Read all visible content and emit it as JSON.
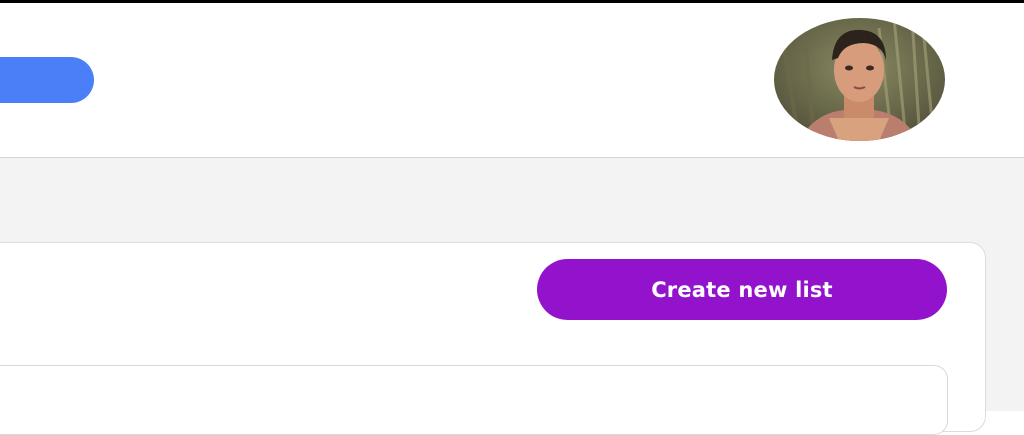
{
  "header": {
    "primary_button_label": "",
    "avatar_icon": "user-avatar-photo"
  },
  "list_panel": {
    "create_button_label": "Create new list"
  },
  "colors": {
    "primary_blue": "#4a7ff7",
    "create_purple": "#9313cc",
    "content_background": "#f3f3f3",
    "card_border": "#dcdcdc"
  }
}
